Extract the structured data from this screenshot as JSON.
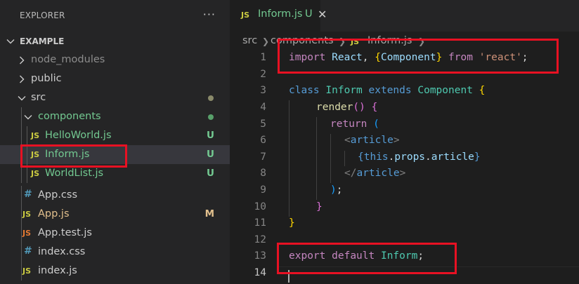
{
  "explorer": {
    "title": "EXPLORER",
    "more": "···",
    "section": "EXAMPLE",
    "items": [
      {
        "label": "node_modules",
        "type": "folder",
        "expanded": false
      },
      {
        "label": "public",
        "type": "folder",
        "expanded": false
      },
      {
        "label": "src",
        "type": "folder",
        "expanded": true
      },
      {
        "label": "components",
        "type": "folder",
        "expanded": true
      },
      {
        "label": "HelloWorld.js",
        "icon": "JS",
        "status": "U"
      },
      {
        "label": "Inform.js",
        "icon": "JS",
        "status": "U",
        "selected": true
      },
      {
        "label": "WorldList.js",
        "icon": "JS",
        "status": "U"
      },
      {
        "label": "App.css",
        "icon": "#"
      },
      {
        "label": "App.js",
        "icon": "JS",
        "status": "M"
      },
      {
        "label": "App.test.js",
        "icon": "JS"
      },
      {
        "label": "index.css",
        "icon": "#"
      },
      {
        "label": "index.js",
        "icon": "JS"
      }
    ]
  },
  "tab": {
    "icon": "JS",
    "label": "Inform.js",
    "status": "U",
    "close": "✕"
  },
  "breadcrumb": {
    "parts": [
      "src",
      "components",
      "Inform.js"
    ],
    "icon": "JS"
  },
  "editor": {
    "line_numbers": [
      "1",
      "2",
      "3",
      "4",
      "5",
      "6",
      "7",
      "8",
      "9",
      "10",
      "11",
      "12",
      "13",
      "14"
    ],
    "tokens": {
      "l1": [
        "import",
        "React",
        ", ",
        "{",
        "Component",
        "}",
        "from",
        "'react'",
        ";"
      ],
      "l3": [
        "class",
        "Inform",
        "extends",
        "Component",
        "{"
      ],
      "l4": [
        "render",
        "()",
        " {"
      ],
      "l5": [
        "return",
        "("
      ],
      "l6": [
        "<",
        "article",
        ">"
      ],
      "l7": [
        "{",
        "this",
        ".",
        "props",
        ".",
        "article",
        "}"
      ],
      "l8": [
        "</",
        "article",
        ">"
      ],
      "l9": [
        ")",
        ";"
      ],
      "l10": [
        "}"
      ],
      "l11": [
        "}"
      ],
      "l13": [
        "export",
        "default",
        "Inform",
        ";"
      ]
    }
  },
  "colors": {
    "highlight": "#e81123",
    "untracked": "#73c991",
    "modified": "#e2c08d"
  }
}
